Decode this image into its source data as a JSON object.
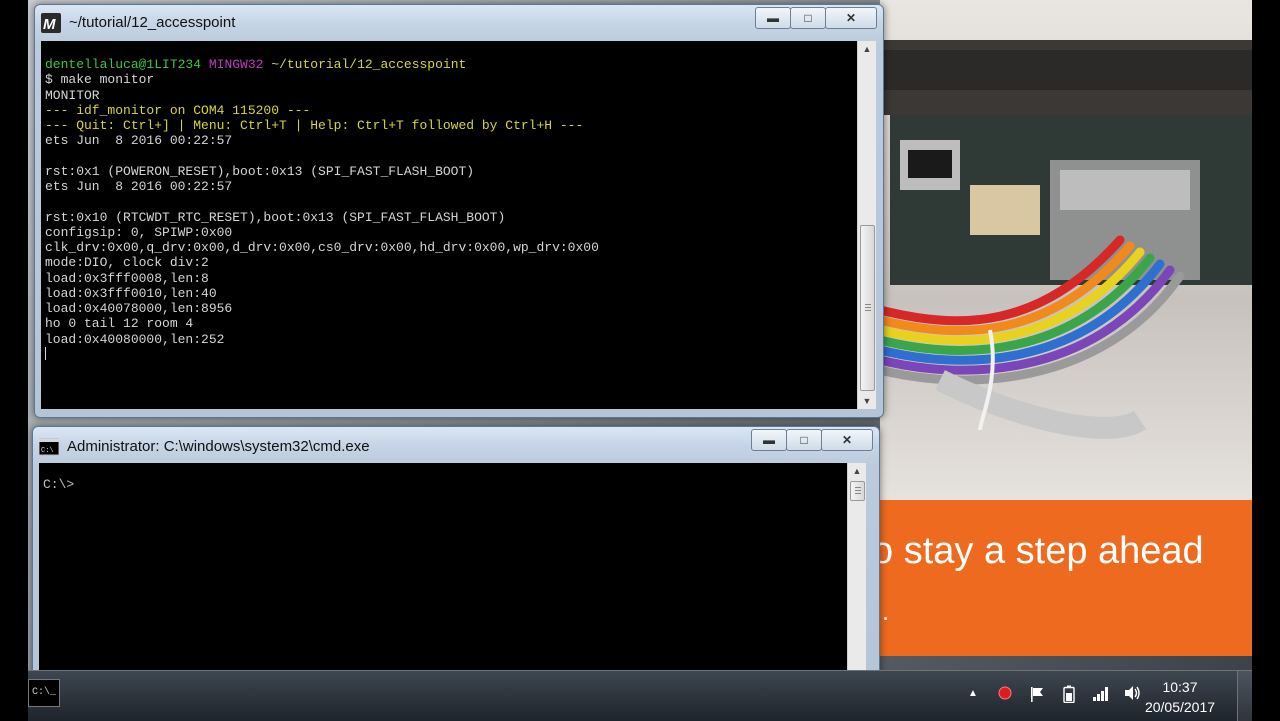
{
  "terminal": {
    "title": "~/tutorial/12_accesspoint",
    "controls": {
      "minimize": "▬",
      "maximize": "□",
      "close": "✕"
    },
    "prompt": {
      "user_host": "dentellaluca@1LIT234",
      "env": "MINGW32",
      "path": "~/tutorial/12_accesspoint"
    },
    "lines": [
      "$ make monitor",
      "MONITOR",
      "--- idf_monitor on COM4 115200 ---",
      "--- Quit: Ctrl+] | Menu: Ctrl+T | Help: Ctrl+T followed by Ctrl+H ---",
      "ets Jun  8 2016 00:22:57",
      "",
      "rst:0x1 (POWERON_RESET),boot:0x13 (SPI_FAST_FLASH_BOOT)",
      "ets Jun  8 2016 00:22:57",
      "",
      "rst:0x10 (RTCWDT_RTC_RESET),boot:0x13 (SPI_FAST_FLASH_BOOT)",
      "configsip: 0, SPIWP:0x00",
      "clk_drv:0x00,q_drv:0x00,d_drv:0x00,cs0_drv:0x00,hd_drv:0x00,wp_drv:0x00",
      "mode:DIO, clock div:2",
      "load:0x3fff0008,len:8",
      "load:0x3fff0010,len:40",
      "load:0x40078000,len:8956",
      "ho 0 tail 12 room 4",
      "load:0x40080000,len:252"
    ]
  },
  "cmd": {
    "title": "Administrator: C:\\windows\\system32\\cmd.exe",
    "icon_text": "C:\\",
    "prompt": "C:\\>"
  },
  "promo": {
    "text": "o stay a step ahead",
    "sub": "."
  },
  "taskbar": {
    "app_label": "C:\\_",
    "tray_icons": [
      "show-hidden-icons",
      "record-icon",
      "flag-icon",
      "battery-icon",
      "signal-icon",
      "volume-icon"
    ],
    "time": "10:37",
    "date": "20/05/2017"
  },
  "colors": {
    "prompt_user": "#3fc43f",
    "prompt_env": "#c23ac2",
    "prompt_path": "#d5d53a",
    "promo_bg": "#ee6a1f"
  }
}
